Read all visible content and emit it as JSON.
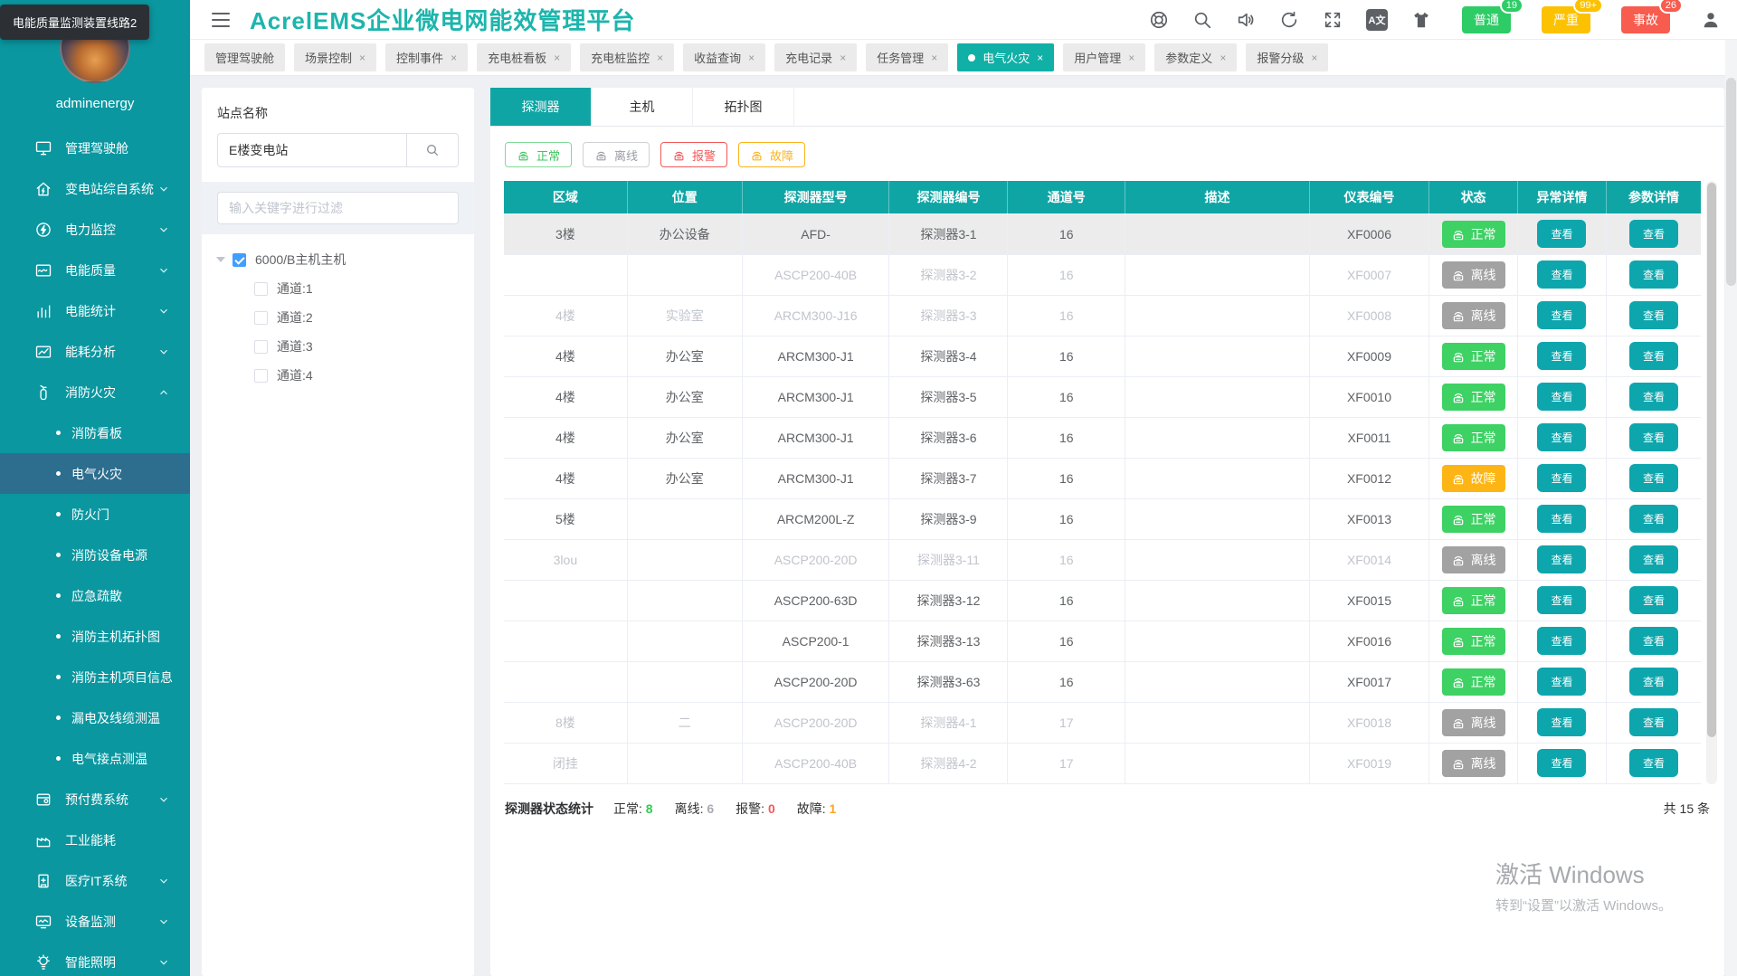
{
  "tooltip": {
    "text": "电能质量监测装置线路2"
  },
  "header": {
    "title": "AcrelEMS企业微电网能效管理平台",
    "icons": [
      "aperture-icon",
      "search-icon",
      "volume-icon",
      "refresh-icon",
      "fullscreen-icon",
      "translate-icon",
      "theme-shirt-icon",
      "user-icon"
    ],
    "translate_label": "A文",
    "alarm_badges": [
      {
        "label": "普通",
        "count": "19",
        "color": "#2ecc66"
      },
      {
        "label": "严重",
        "count": "99+",
        "color": "#fcc100"
      },
      {
        "label": "事故",
        "count": "26",
        "color": "#f75c4e"
      }
    ]
  },
  "tabs": [
    {
      "label": "管理驾驶舱",
      "closable": false,
      "active": false
    },
    {
      "label": "场景控制",
      "closable": true,
      "active": false
    },
    {
      "label": "控制事件",
      "closable": true,
      "active": false
    },
    {
      "label": "充电桩看板",
      "closable": true,
      "active": false
    },
    {
      "label": "充电桩监控",
      "closable": true,
      "active": false
    },
    {
      "label": "收益查询",
      "closable": true,
      "active": false
    },
    {
      "label": "充电记录",
      "closable": true,
      "active": false
    },
    {
      "label": "任务管理",
      "closable": true,
      "active": false
    },
    {
      "label": "电气火灾",
      "closable": true,
      "active": true
    },
    {
      "label": "用户管理",
      "closable": true,
      "active": false
    },
    {
      "label": "参数定义",
      "closable": true,
      "active": false
    },
    {
      "label": "报警分级",
      "closable": true,
      "active": false
    }
  ],
  "sidebar": {
    "username": "adminenergy",
    "items": [
      {
        "label": "管理驾驶舱",
        "icon": "dashboard-icon",
        "chevron": "none"
      },
      {
        "label": "变电站综自系统",
        "icon": "substation-icon",
        "chevron": "down"
      },
      {
        "label": "电力监控",
        "icon": "power-monitor-icon",
        "chevron": "down"
      },
      {
        "label": "电能质量",
        "icon": "power-quality-icon",
        "chevron": "down"
      },
      {
        "label": "电能统计",
        "icon": "energy-stats-icon",
        "chevron": "down"
      },
      {
        "label": "能耗分析",
        "icon": "energy-analysis-icon",
        "chevron": "down"
      },
      {
        "label": "消防火灾",
        "icon": "fire-icon",
        "chevron": "up",
        "children": [
          "消防看板",
          "电气火灾",
          "防火门",
          "消防设备电源",
          "应急疏散",
          "消防主机拓扑图",
          "消防主机项目信息",
          "漏电及线缆测温",
          "电气接点测温"
        ],
        "active_child": "电气火灾"
      },
      {
        "label": "预付费系统",
        "icon": "prepaid-icon",
        "chevron": "down"
      },
      {
        "label": "工业能耗",
        "icon": "industry-icon",
        "chevron": "none"
      },
      {
        "label": "医疗IT系统",
        "icon": "hospital-icon",
        "chevron": "down"
      },
      {
        "label": "设备监测",
        "icon": "device-monitor-icon",
        "chevron": "down"
      },
      {
        "label": "智能照明",
        "icon": "lighting-icon",
        "chevron": "down"
      }
    ]
  },
  "station_panel": {
    "label": "站点名称",
    "search_value": "E楼变电站",
    "filter_placeholder": "输入关键字进行过滤",
    "tree": {
      "root": {
        "label": "6000/B主机主机",
        "checked": true
      },
      "children": [
        "通道:1",
        "通道:2",
        "通道:3",
        "通道:4"
      ]
    }
  },
  "detector_panel": {
    "tabs": [
      "探测器",
      "主机",
      "拓扑图"
    ],
    "active_tab": 0,
    "filters": [
      {
        "key": "normal",
        "label": "正常"
      },
      {
        "key": "offline",
        "label": "离线"
      },
      {
        "key": "alarm",
        "label": "报警"
      },
      {
        "key": "fault",
        "label": "故障"
      }
    ],
    "statuses": {
      "normal": {
        "label": "正常",
        "color": "#3ed164"
      },
      "offline": {
        "label": "离线",
        "color": "#a2a2a2"
      },
      "alarm": {
        "label": "报警",
        "color": "#f25858"
      },
      "fault": {
        "label": "故障",
        "color": "#fdb515"
      }
    },
    "view_label": "查看",
    "table": {
      "headers": [
        "区域",
        "位置",
        "探测器型号",
        "探测器编号",
        "通道号",
        "描述",
        "仪表编号",
        "状态",
        "异常详情",
        "参数详情"
      ],
      "rows": [
        {
          "area": "3楼",
          "location": "办公设备",
          "model": "AFD-",
          "code": "探测器3-1",
          "channel": "16",
          "desc": "",
          "meter": "XF0006",
          "status": "normal",
          "selected": true
        },
        {
          "area": "",
          "location": "",
          "model": "ASCP200-40B",
          "code": "探测器3-2",
          "channel": "16",
          "desc": "",
          "meter": "XF0007",
          "status": "offline",
          "selected": false
        },
        {
          "area": "4楼",
          "location": "实验室",
          "model": "ARCM300-J16",
          "code": "探测器3-3",
          "channel": "16",
          "desc": "",
          "meter": "XF0008",
          "status": "offline",
          "selected": false
        },
        {
          "area": "4楼",
          "location": "办公室",
          "model": "ARCM300-J1",
          "code": "探测器3-4",
          "channel": "16",
          "desc": "",
          "meter": "XF0009",
          "status": "normal",
          "selected": false
        },
        {
          "area": "4楼",
          "location": "办公室",
          "model": "ARCM300-J1",
          "code": "探测器3-5",
          "channel": "16",
          "desc": "",
          "meter": "XF0010",
          "status": "normal",
          "selected": false
        },
        {
          "area": "4楼",
          "location": "办公室",
          "model": "ARCM300-J1",
          "code": "探测器3-6",
          "channel": "16",
          "desc": "",
          "meter": "XF0011",
          "status": "normal",
          "selected": false
        },
        {
          "area": "4楼",
          "location": "办公室",
          "model": "ARCM300-J1",
          "code": "探测器3-7",
          "channel": "16",
          "desc": "",
          "meter": "XF0012",
          "status": "fault",
          "selected": false
        },
        {
          "area": "5楼",
          "location": "",
          "model": "ARCM200L-Z",
          "code": "探测器3-9",
          "channel": "16",
          "desc": "",
          "meter": "XF0013",
          "status": "normal",
          "selected": false
        },
        {
          "area": "3lou",
          "location": "",
          "model": "ASCP200-20D",
          "code": "探测器3-11",
          "channel": "16",
          "desc": "",
          "meter": "XF0014",
          "status": "offline",
          "selected": false
        },
        {
          "area": "",
          "location": "",
          "model": "ASCP200-63D",
          "code": "探测器3-12",
          "channel": "16",
          "desc": "",
          "meter": "XF0015",
          "status": "normal",
          "selected": false
        },
        {
          "area": "",
          "location": "",
          "model": "ASCP200-1",
          "code": "探测器3-13",
          "channel": "16",
          "desc": "",
          "meter": "XF0016",
          "status": "normal",
          "selected": false
        },
        {
          "area": "",
          "location": "",
          "model": "ASCP200-20D",
          "code": "探测器3-63",
          "channel": "16",
          "desc": "",
          "meter": "XF0017",
          "status": "normal",
          "selected": false
        },
        {
          "area": "8楼",
          "location": "二",
          "model": "ASCP200-20D",
          "code": "探测器4-1",
          "channel": "17",
          "desc": "",
          "meter": "XF0018",
          "status": "offline",
          "selected": false
        },
        {
          "area": "闭挂",
          "location": "",
          "model": "ASCP200-40B",
          "code": "探测器4-2",
          "channel": "17",
          "desc": "",
          "meter": "XF0019",
          "status": "offline",
          "selected": false
        }
      ]
    },
    "summary": {
      "title": "探测器状态统计",
      "items": [
        {
          "label": "正常",
          "value": "8",
          "color": "#2ecc51"
        },
        {
          "label": "离线",
          "value": "6",
          "color": "#a8abb2"
        },
        {
          "label": "报警",
          "value": "0",
          "color": "#f25858"
        },
        {
          "label": "故障",
          "value": "1",
          "color": "#fba524"
        }
      ]
    },
    "total": "共 15 条"
  },
  "watermark": {
    "line1": "激活 Windows",
    "line2": "转到“设置”以激活 Windows。"
  },
  "colors": {
    "sidebar_teal": "#0b97a0",
    "sidebar_active": "#2d6e8f",
    "brand_teal": "#1cb5ac",
    "table_header_teal": "#10a5a5",
    "view_button_teal": "#0da6ad"
  }
}
